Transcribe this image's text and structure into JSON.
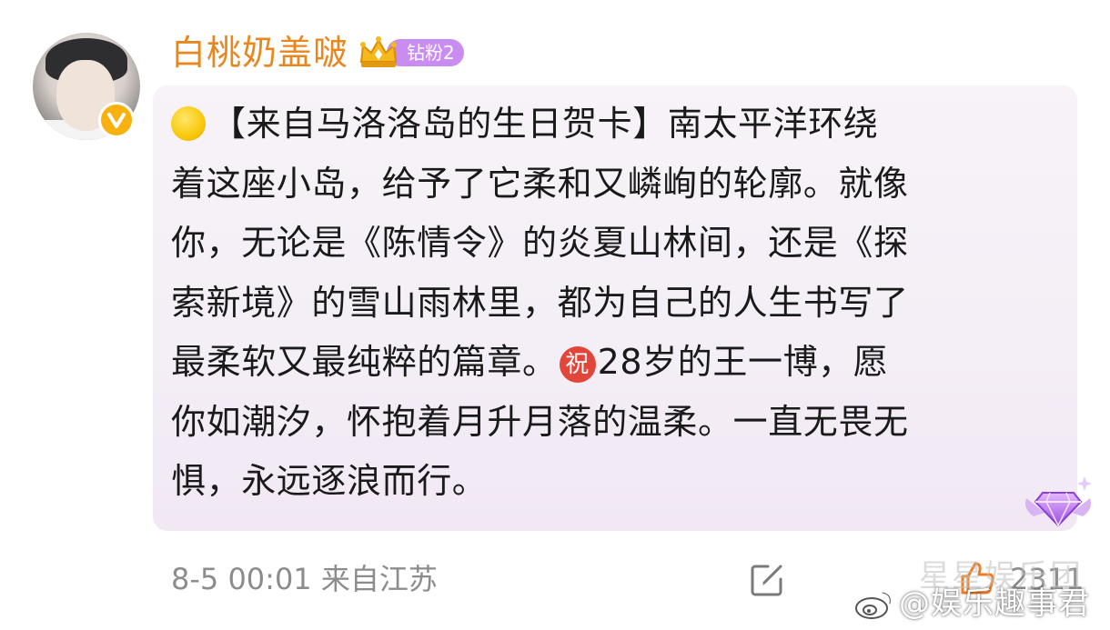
{
  "user": {
    "name": "白桃奶盖啵",
    "badge_label": "钻粉2",
    "verified": true
  },
  "post": {
    "lines": [
      {
        "segments": [
          {
            "type": "icon",
            "name": "yellow-circle-emoji"
          },
          {
            "type": "text",
            "value": "【来自马洛洛岛的生日贺卡】南太平洋环绕"
          }
        ]
      },
      {
        "segments": [
          {
            "type": "text",
            "value": "着这座小岛，给予了它柔和又嶙峋的轮廓。就像"
          }
        ]
      },
      {
        "segments": [
          {
            "type": "text",
            "value": "你，无论是《陈情令》的炎夏山林间，还是《探"
          }
        ]
      },
      {
        "segments": [
          {
            "type": "text",
            "value": "索新境》的雪山雨林里，都为自己的人生书写了"
          }
        ]
      },
      {
        "segments": [
          {
            "type": "text",
            "value": "最柔软又最纯粹的篇章。"
          },
          {
            "type": "icon",
            "name": "zhu-emoji",
            "glyph": "祝"
          },
          {
            "type": "text",
            "value": "28岁的王一博，愿"
          }
        ]
      },
      {
        "segments": [
          {
            "type": "text",
            "value": "你如潮汐，怀抱着月升月落的温柔。一直无畏无"
          }
        ]
      },
      {
        "segments": [
          {
            "type": "text",
            "value": "惧，永远逐浪而行。"
          }
        ]
      }
    ]
  },
  "footer": {
    "timestamp": "8-5 00:01",
    "location": "来自江苏",
    "like_count": "2311"
  },
  "watermark": {
    "line1": "星星娱乐团",
    "line2": "@娱乐趣事君"
  },
  "colors": {
    "username": "#e8871e",
    "badge": "#c98cf0",
    "verified": "#f7b20f",
    "card_background": "#f5f0f7",
    "meta_text": "#8c8c8c"
  }
}
